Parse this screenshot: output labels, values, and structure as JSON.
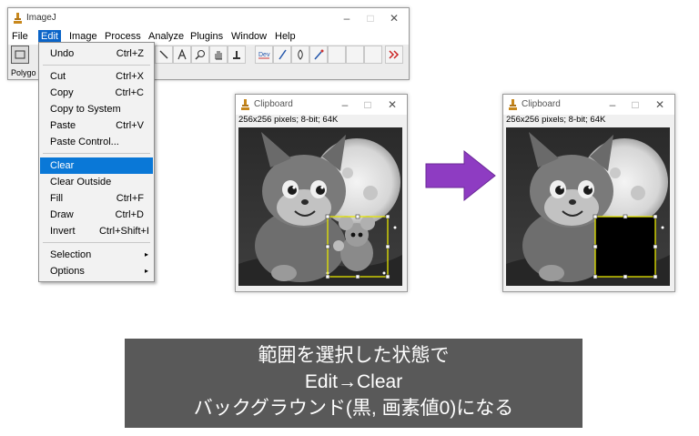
{
  "imagej": {
    "title": "ImageJ",
    "window_controls": {
      "minimize": "–",
      "maximize": "□",
      "close": "✕"
    },
    "menu": [
      "File",
      "Edit",
      "Image",
      "Process",
      "Analyze",
      "Plugins",
      "Window",
      "Help"
    ],
    "active_menu": "Edit",
    "status_text": "Polygo",
    "tools": [
      "rectangle-tool",
      "line-tool",
      "text-tool",
      "zoom-tool",
      "hand-tool",
      "dropper-tool",
      "dev-tool",
      "pencil-tool",
      "brush-tool",
      "wand-tool",
      "more-tools"
    ]
  },
  "edit_menu": {
    "items": [
      {
        "label": "Undo",
        "shortcut": "Ctrl+Z"
      },
      {
        "label": "Cut",
        "shortcut": "Ctrl+X"
      },
      {
        "label": "Copy",
        "shortcut": "Ctrl+C"
      },
      {
        "label": "Copy to System",
        "shortcut": ""
      },
      {
        "label": "Paste",
        "shortcut": "Ctrl+V"
      },
      {
        "label": "Paste Control...",
        "shortcut": ""
      },
      {
        "label": "Clear",
        "shortcut": ""
      },
      {
        "label": "Clear Outside",
        "shortcut": ""
      },
      {
        "label": "Fill",
        "shortcut": "Ctrl+F"
      },
      {
        "label": "Draw",
        "shortcut": "Ctrl+D"
      },
      {
        "label": "Invert",
        "shortcut": "Ctrl+Shift+I"
      },
      {
        "label": "Selection",
        "shortcut": "▸"
      },
      {
        "label": "Options",
        "shortcut": "▸"
      }
    ],
    "highlighted": "Clear"
  },
  "clipboard_before": {
    "title": "Clipboard",
    "info": "256x256 pixels; 8-bit; 64K"
  },
  "clipboard_after": {
    "title": "Clipboard",
    "info": "256x256 pixels; 8-bit; 64K"
  },
  "caption": {
    "line1": "範囲を選択した状態で",
    "line2": "Edit→Clear",
    "line3": "バックグラウンド(黒, 画素値0)になる"
  },
  "colors": {
    "menu_highlight": "#0a78d7",
    "arrow": "#8e3cc2",
    "selection": "#e6e600",
    "caption_bg": "#595959"
  }
}
